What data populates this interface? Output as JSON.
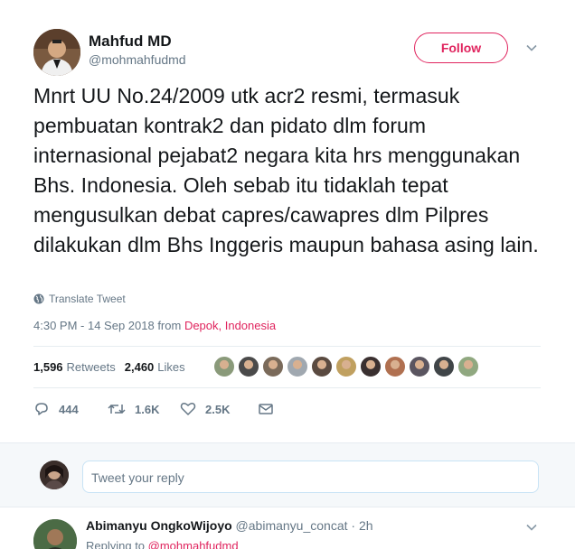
{
  "author": {
    "name": "Mahfud MD",
    "handle": "@mohmahfudmd"
  },
  "follow_label": "Follow",
  "tweet_text": "Mnrt UU No.24/2009 utk acr2 resmi, termasuk pembuatan kontrak2 dan pidato dlm forum internasional pejabat2 negara kita hrs menggunakan Bhs. Indonesia. Oleh sebab itu tidaklah tepat mengusulkan debat capres/cawapres dlm Pilpres dilakukan dlm Bhs Inggeris maupun bahasa asing lain.",
  "translate_label": "Translate Tweet",
  "timestamp": "4:30 PM - 14 Sep 2018 from ",
  "location": "Depok, Indonesia",
  "stats": {
    "retweets_count": "1,596",
    "retweets_label": "Retweets",
    "likes_count": "2,460",
    "likes_label": "Likes"
  },
  "liker_colors": [
    "#8a9a7a",
    "#4a4a4a",
    "#7a6a5a",
    "#a0a8b0",
    "#5a4a40",
    "#c0a060",
    "#3a3030",
    "#b07050",
    "#5a5560",
    "#404548",
    "#90a880"
  ],
  "actions": {
    "replies": "444",
    "retweets": "1.6K",
    "likes": "2.5K"
  },
  "reply_placeholder": "Tweet your reply",
  "reply": {
    "name": "Abimanyu OngkoWijoyo",
    "handle": "@abimanyu_concat · 2h",
    "replying_label": "Replying to ",
    "replying_to": "@mohmahfudmd"
  },
  "colors": {
    "accent": "#e0245e",
    "muted": "#657786",
    "text": "#14171a"
  }
}
